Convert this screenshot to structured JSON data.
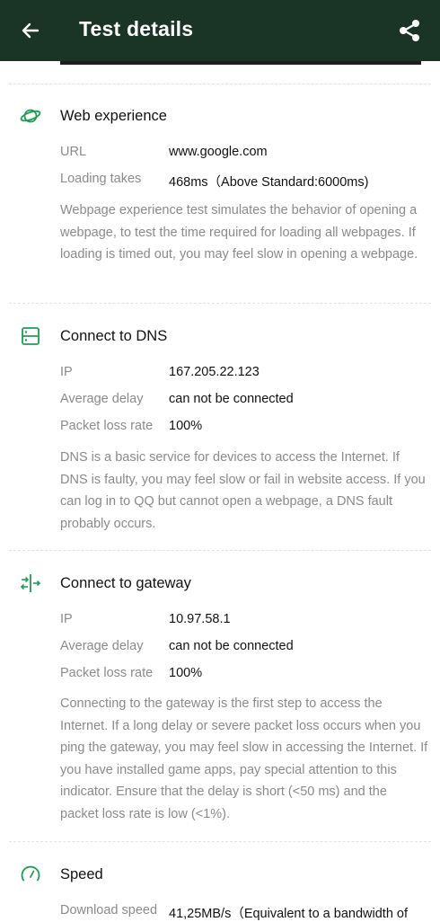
{
  "header": {
    "title": "Test details",
    "back_icon": "arrow-left-icon",
    "share_icon": "share-icon"
  },
  "web": {
    "title": "Web experience",
    "icon": "planet-icon",
    "rows": [
      {
        "label": "URL",
        "value": "www.google.com"
      },
      {
        "label": "Loading takes",
        "value": "468ms（Above Standard:6000ms)"
      }
    ],
    "desc": "Webpage experience test simulates the behavior of opening a webpage, to test the time required for loading all webpages. If loading is timed out, you may feel slow in opening a webpage."
  },
  "dns": {
    "title": "Connect to DNS",
    "icon": "server-icon",
    "rows": [
      {
        "label": "IP",
        "value": "167.205.22.123"
      },
      {
        "label": "Average delay",
        "value": "can not be connected"
      },
      {
        "label": "Packet loss rate",
        "value": "100%"
      }
    ],
    "desc": "DNS is a basic service for devices to access the Internet. If DNS is faulty, you may feel slow or fail in website access. If you can log in to QQ but cannot open a webpage, a DNS fault probably occurs."
  },
  "gateway": {
    "title": "Connect to gateway",
    "icon": "gateway-icon",
    "rows": [
      {
        "label": "IP",
        "value": "10.97.58.1"
      },
      {
        "label": "Average delay",
        "value": "can not be connected"
      },
      {
        "label": "Packet loss rate",
        "value": "100%"
      }
    ],
    "desc": "Connecting to the gateway is the first step to access the Internet. If a long delay or severe packet loss occurs when you ping the gateway, you may feel slow in accessing the Internet. If you have installed game apps, pay special attention to this indicator. Ensure that the delay is short (<50 ms) and the packet loss rate is low (<1%)."
  },
  "speed": {
    "title": "Speed",
    "icon": "speedometer-icon",
    "rows": [
      {
        "label": "Download speed",
        "value": "41,25MB/s（Equivalent to a bandwidth of"
      }
    ]
  },
  "colors": {
    "appbar": "#1a3526",
    "accent": "#1f9d55"
  }
}
